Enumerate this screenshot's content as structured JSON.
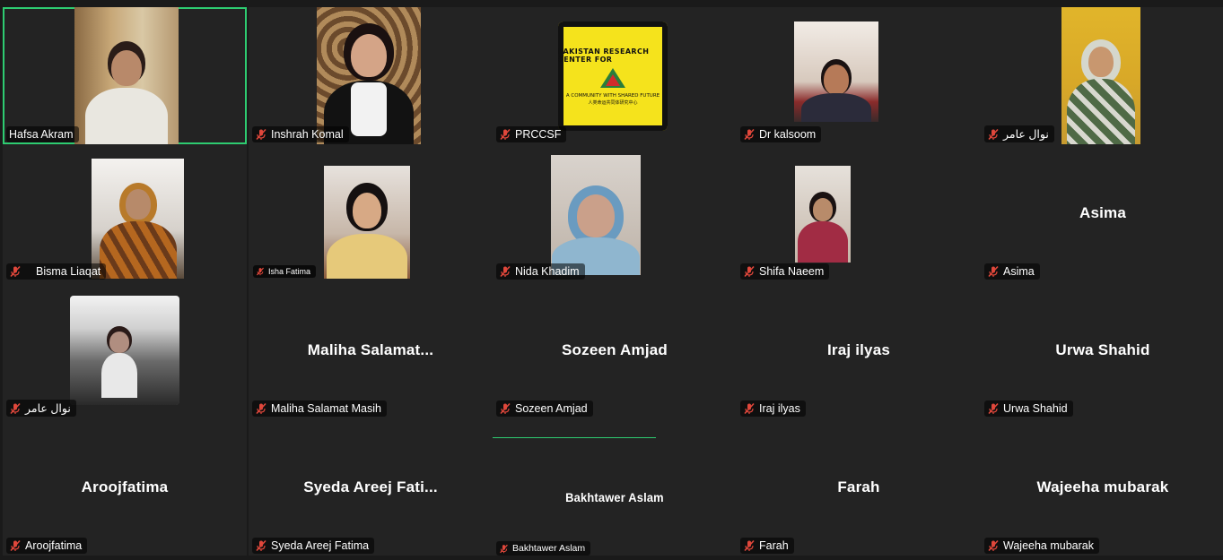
{
  "participants": [
    {
      "name": "Hafsa Akram",
      "video": true,
      "active": true,
      "muted": false
    },
    {
      "name": "Inshrah Komal",
      "video": true,
      "muted": true
    },
    {
      "name": "PRCCSF",
      "video": true,
      "logo": true,
      "muted": true,
      "logo_text": "PAKISTAN RESEARCH CENTER FOR",
      "logo_sub": "A COMMUNITY WITH SHARED FUTURE",
      "logo_cn": "人类命运共同体研究中心"
    },
    {
      "name": "Dr kalsoom",
      "video": true,
      "muted": true
    },
    {
      "name": "نوال عامر",
      "video": true,
      "muted": true
    },
    {
      "name": "Bisma Liaqat",
      "video": true,
      "muted": true
    },
    {
      "name": "Isha Fatima",
      "video": true,
      "muted": true
    },
    {
      "name": "Nida Khadim",
      "video": true,
      "muted": true
    },
    {
      "name": "Shifa Naeem",
      "video": true,
      "muted": true
    },
    {
      "name": "Asima",
      "display": "Asima",
      "video": false,
      "muted": true
    },
    {
      "name": "نوال عامر",
      "video": true,
      "muted": true
    },
    {
      "name": "Maliha Salamat Masih",
      "display": "Maliha  Salamat...",
      "video": false,
      "muted": true
    },
    {
      "name": "Sozeen Amjad",
      "display": "Sozeen Amjad",
      "video": false,
      "muted": true
    },
    {
      "name": "Iraj ilyas",
      "display": "Iraj ilyas",
      "video": false,
      "muted": true
    },
    {
      "name": "Urwa Shahid",
      "display": "Urwa Shahid",
      "video": false,
      "muted": true
    },
    {
      "name": "Aroojfatima",
      "display": "Aroojfatima",
      "video": false,
      "muted": true
    },
    {
      "name": "Syeda Areej Fatima",
      "display": "Syeda  Areej  Fati...",
      "video": false,
      "muted": true
    },
    {
      "name": "Bakhtawer Aslam",
      "display": "Bakhtawer Aslam",
      "video": false,
      "muted": true
    },
    {
      "name": "Farah",
      "display": "Farah",
      "video": false,
      "muted": true
    },
    {
      "name": "Wajeeha mubarak",
      "display": "Wajeeha mubarak",
      "video": false,
      "muted": true
    }
  ],
  "colors": {
    "background": "#1a1a1a",
    "tile": "#232323",
    "active_border": "#2ecc71",
    "muted_icon": "#e0473b",
    "logo_yellow": "#f5e31c"
  }
}
